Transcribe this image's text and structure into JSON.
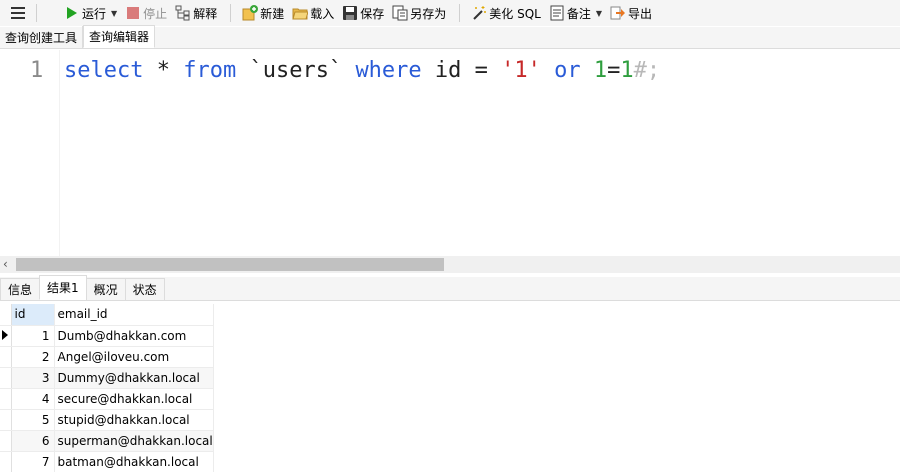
{
  "toolbar": {
    "run": "运行",
    "stop": "停止",
    "explain": "解释",
    "new": "新建",
    "load": "载入",
    "save": "保存",
    "save_as": "另存为",
    "beautify": "美化 SQL",
    "comment": "备注",
    "export": "导出"
  },
  "query_tabs": [
    "查询创建工具",
    "查询编辑器"
  ],
  "editor": {
    "line_number": "1",
    "tokens": {
      "select": "select",
      "star": " * ",
      "from": "from",
      "table": " `users` ",
      "where": "where",
      "cond": " id = ",
      "str": "'1'",
      "sp": " ",
      "or": "or",
      "sp2": " ",
      "n1": "1",
      "eq": "=",
      "n2": "1",
      "comment": "#;"
    }
  },
  "result_tabs": [
    "信息",
    "结果1",
    "概况",
    "状态"
  ],
  "grid": {
    "columns": [
      "id",
      "email_id"
    ],
    "rows": [
      {
        "id": "1",
        "email": "Dumb@dhakkan.com"
      },
      {
        "id": "2",
        "email": "Angel@iloveu.com"
      },
      {
        "id": "3",
        "email": "Dummy@dhakkan.local"
      },
      {
        "id": "4",
        "email": "secure@dhakkan.local"
      },
      {
        "id": "5",
        "email": "stupid@dhakkan.local"
      },
      {
        "id": "6",
        "email": "superman@dhakkan.local"
      },
      {
        "id": "7",
        "email": "batman@dhakkan.local"
      }
    ]
  },
  "colors": {
    "run_green": "#22a322",
    "stop_red": "#d97a7a",
    "keyword_blue": "#2a5bd7",
    "string_red": "#c62828",
    "number_green": "#2e9e3e",
    "comment_gray": "#b8b8b8"
  }
}
